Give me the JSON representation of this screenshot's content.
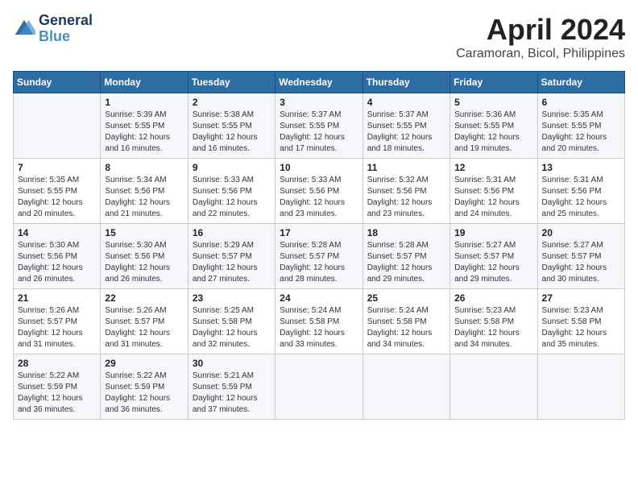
{
  "header": {
    "logo_line1": "General",
    "logo_line2": "Blue",
    "title": "April 2024",
    "subtitle": "Caramoran, Bicol, Philippines"
  },
  "weekdays": [
    "Sunday",
    "Monday",
    "Tuesday",
    "Wednesday",
    "Thursday",
    "Friday",
    "Saturday"
  ],
  "weeks": [
    [
      {
        "day": null
      },
      {
        "day": "1",
        "sunrise": "5:39 AM",
        "sunset": "5:55 PM",
        "daylight": "12 hours and 16 minutes."
      },
      {
        "day": "2",
        "sunrise": "5:38 AM",
        "sunset": "5:55 PM",
        "daylight": "12 hours and 16 minutes."
      },
      {
        "day": "3",
        "sunrise": "5:37 AM",
        "sunset": "5:55 PM",
        "daylight": "12 hours and 17 minutes."
      },
      {
        "day": "4",
        "sunrise": "5:37 AM",
        "sunset": "5:55 PM",
        "daylight": "12 hours and 18 minutes."
      },
      {
        "day": "5",
        "sunrise": "5:36 AM",
        "sunset": "5:55 PM",
        "daylight": "12 hours and 19 minutes."
      },
      {
        "day": "6",
        "sunrise": "5:35 AM",
        "sunset": "5:55 PM",
        "daylight": "12 hours and 20 minutes."
      }
    ],
    [
      {
        "day": "7",
        "sunrise": "5:35 AM",
        "sunset": "5:55 PM",
        "daylight": "12 hours and 20 minutes."
      },
      {
        "day": "8",
        "sunrise": "5:34 AM",
        "sunset": "5:56 PM",
        "daylight": "12 hours and 21 minutes."
      },
      {
        "day": "9",
        "sunrise": "5:33 AM",
        "sunset": "5:56 PM",
        "daylight": "12 hours and 22 minutes."
      },
      {
        "day": "10",
        "sunrise": "5:33 AM",
        "sunset": "5:56 PM",
        "daylight": "12 hours and 23 minutes."
      },
      {
        "day": "11",
        "sunrise": "5:32 AM",
        "sunset": "5:56 PM",
        "daylight": "12 hours and 23 minutes."
      },
      {
        "day": "12",
        "sunrise": "5:31 AM",
        "sunset": "5:56 PM",
        "daylight": "12 hours and 24 minutes."
      },
      {
        "day": "13",
        "sunrise": "5:31 AM",
        "sunset": "5:56 PM",
        "daylight": "12 hours and 25 minutes."
      }
    ],
    [
      {
        "day": "14",
        "sunrise": "5:30 AM",
        "sunset": "5:56 PM",
        "daylight": "12 hours and 26 minutes."
      },
      {
        "day": "15",
        "sunrise": "5:30 AM",
        "sunset": "5:56 PM",
        "daylight": "12 hours and 26 minutes."
      },
      {
        "day": "16",
        "sunrise": "5:29 AM",
        "sunset": "5:57 PM",
        "daylight": "12 hours and 27 minutes."
      },
      {
        "day": "17",
        "sunrise": "5:28 AM",
        "sunset": "5:57 PM",
        "daylight": "12 hours and 28 minutes."
      },
      {
        "day": "18",
        "sunrise": "5:28 AM",
        "sunset": "5:57 PM",
        "daylight": "12 hours and 29 minutes."
      },
      {
        "day": "19",
        "sunrise": "5:27 AM",
        "sunset": "5:57 PM",
        "daylight": "12 hours and 29 minutes."
      },
      {
        "day": "20",
        "sunrise": "5:27 AM",
        "sunset": "5:57 PM",
        "daylight": "12 hours and 30 minutes."
      }
    ],
    [
      {
        "day": "21",
        "sunrise": "5:26 AM",
        "sunset": "5:57 PM",
        "daylight": "12 hours and 31 minutes."
      },
      {
        "day": "22",
        "sunrise": "5:26 AM",
        "sunset": "5:57 PM",
        "daylight": "12 hours and 31 minutes."
      },
      {
        "day": "23",
        "sunrise": "5:25 AM",
        "sunset": "5:58 PM",
        "daylight": "12 hours and 32 minutes."
      },
      {
        "day": "24",
        "sunrise": "5:24 AM",
        "sunset": "5:58 PM",
        "daylight": "12 hours and 33 minutes."
      },
      {
        "day": "25",
        "sunrise": "5:24 AM",
        "sunset": "5:58 PM",
        "daylight": "12 hours and 34 minutes."
      },
      {
        "day": "26",
        "sunrise": "5:23 AM",
        "sunset": "5:58 PM",
        "daylight": "12 hours and 34 minutes."
      },
      {
        "day": "27",
        "sunrise": "5:23 AM",
        "sunset": "5:58 PM",
        "daylight": "12 hours and 35 minutes."
      }
    ],
    [
      {
        "day": "28",
        "sunrise": "5:22 AM",
        "sunset": "5:59 PM",
        "daylight": "12 hours and 36 minutes."
      },
      {
        "day": "29",
        "sunrise": "5:22 AM",
        "sunset": "5:59 PM",
        "daylight": "12 hours and 36 minutes."
      },
      {
        "day": "30",
        "sunrise": "5:21 AM",
        "sunset": "5:59 PM",
        "daylight": "12 hours and 37 minutes."
      },
      {
        "day": null
      },
      {
        "day": null
      },
      {
        "day": null
      },
      {
        "day": null
      }
    ]
  ]
}
